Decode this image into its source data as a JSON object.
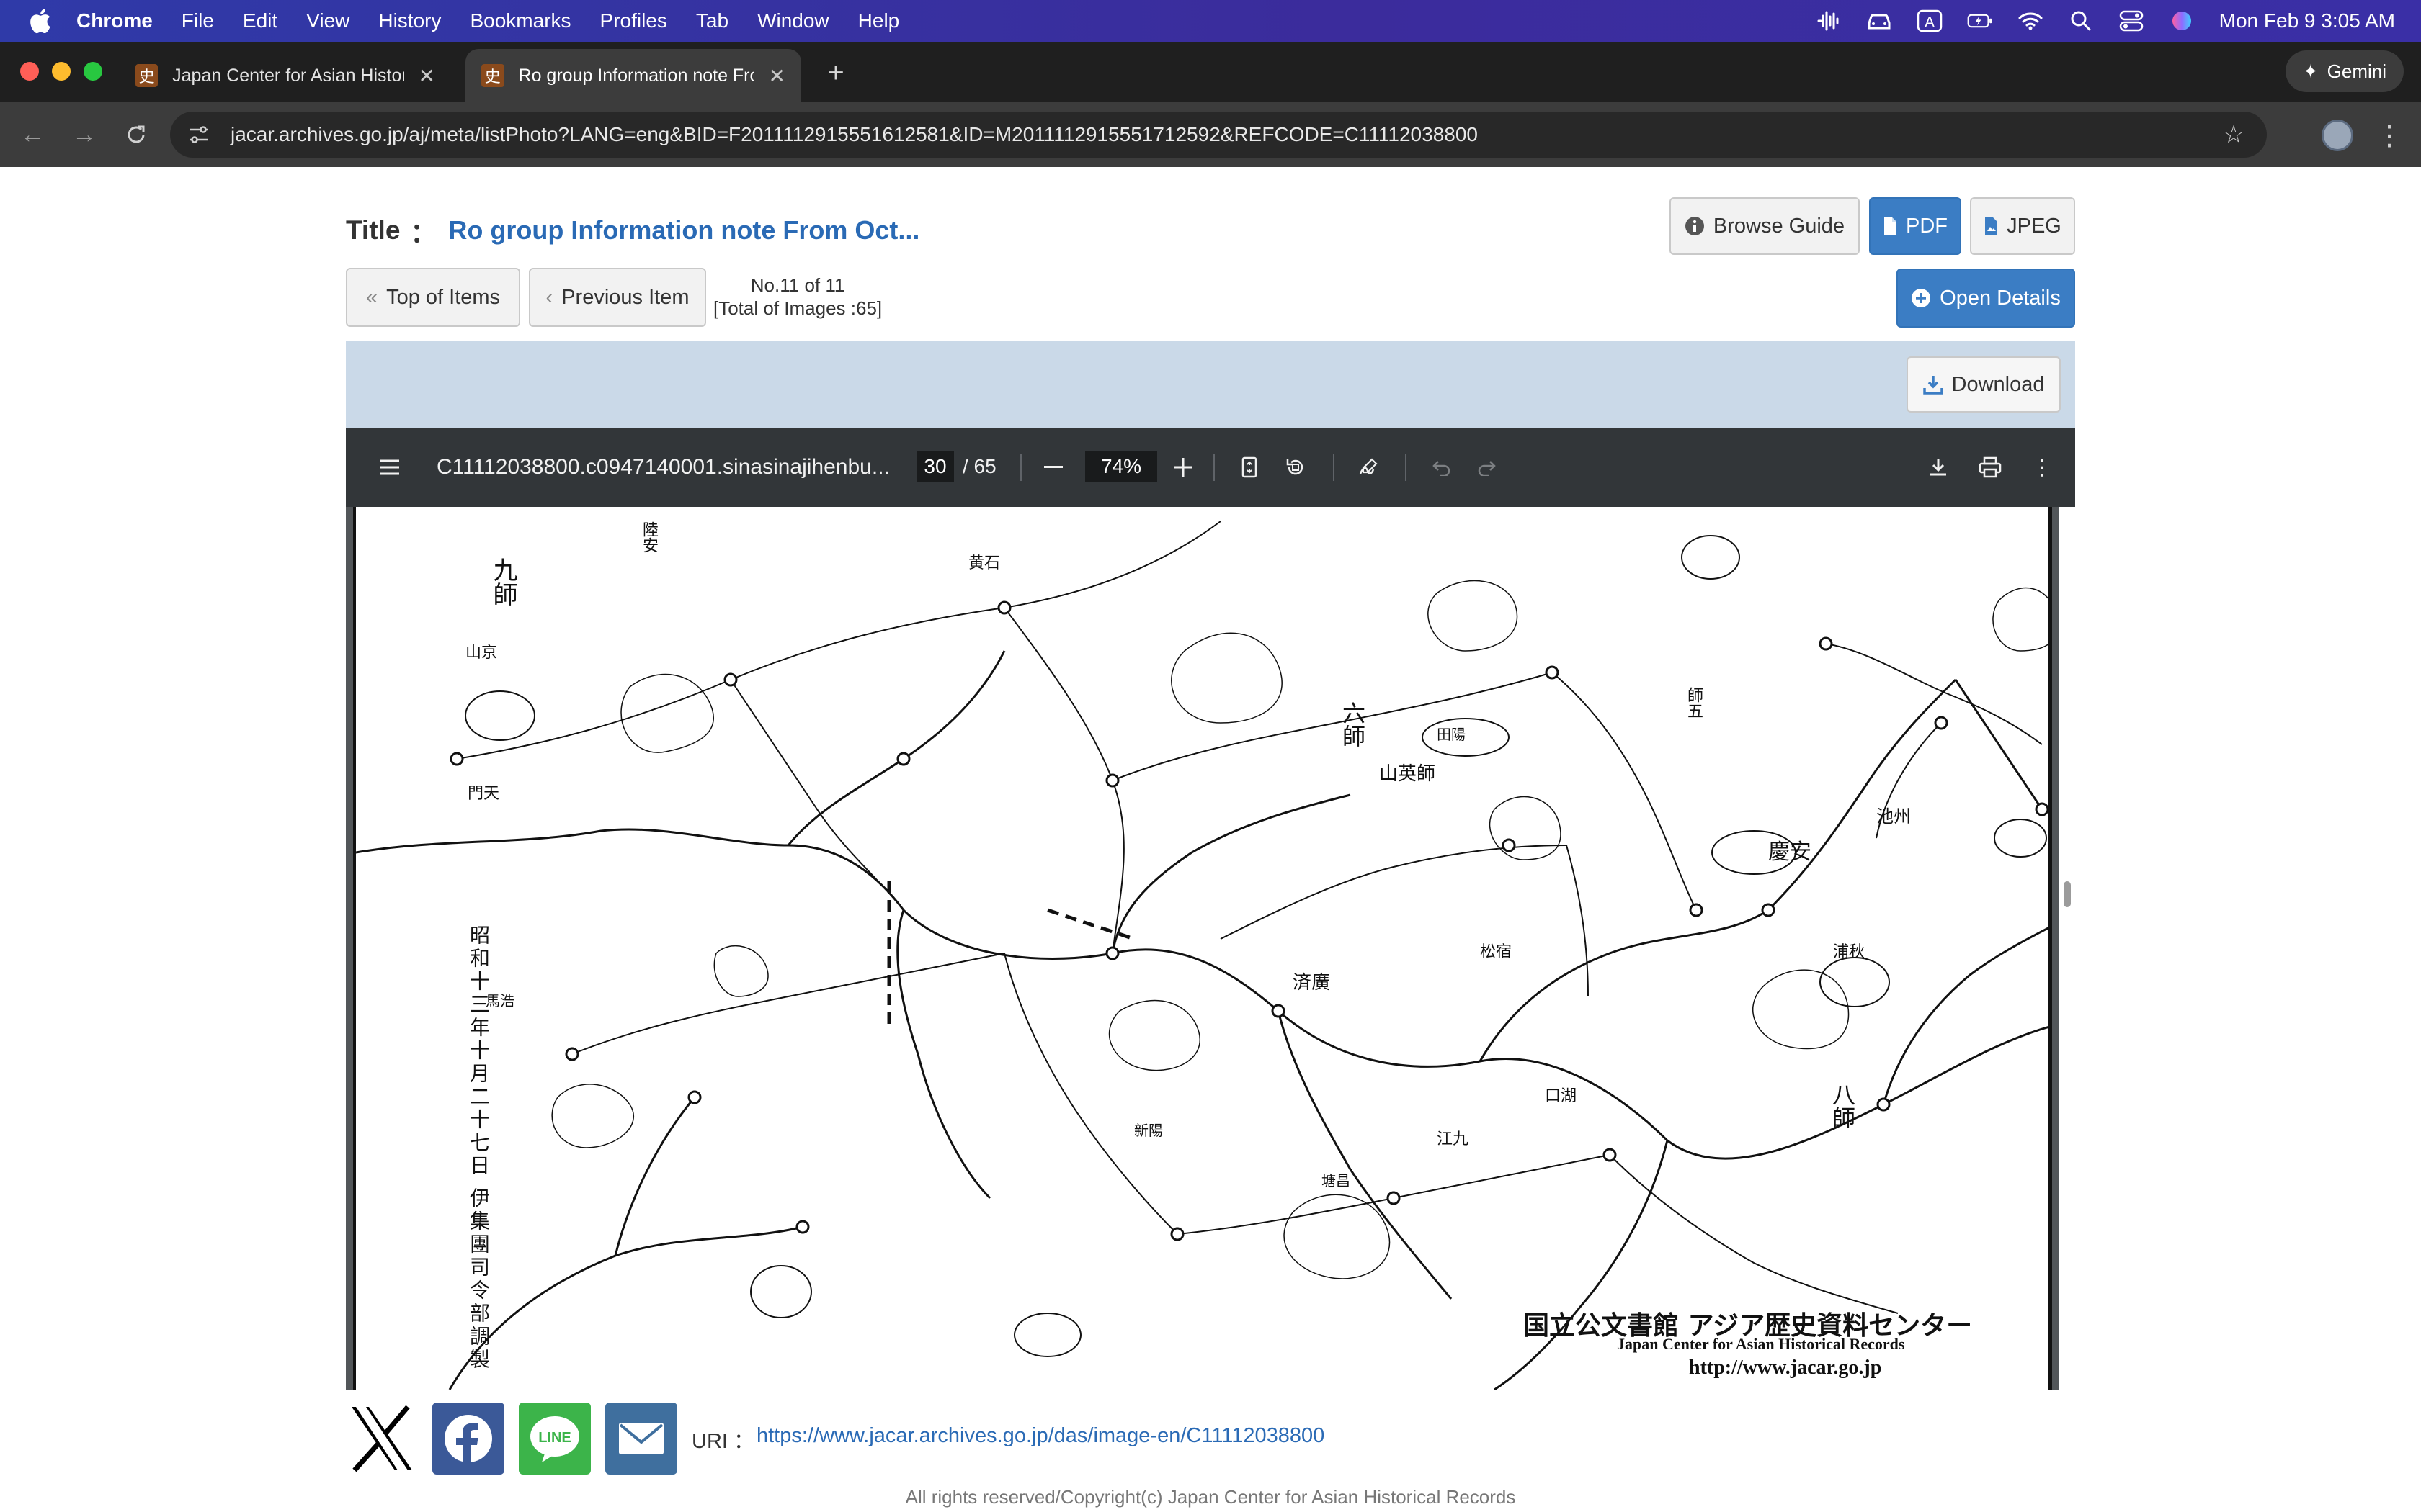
{
  "menubar": {
    "app": "Chrome",
    "items": [
      "File",
      "Edit",
      "View",
      "History",
      "Bookmarks",
      "Profiles",
      "Tab",
      "Window",
      "Help"
    ],
    "clock": "Mon Feb 9  3:05 AM"
  },
  "tabs": [
    {
      "title": "Japan Center for Asian Historical Records",
      "favicon": "史",
      "active": false
    },
    {
      "title": "Ro group Information note From Oct...",
      "favicon": "史",
      "active": true
    }
  ],
  "gemini": {
    "label": "Gemini"
  },
  "address": {
    "url": "jacar.archives.go.jp/aj/meta/listPhoto?LANG=eng&BID=F2011112915551612581&ID=M2011112915551712592&REFCODE=C11112038800"
  },
  "header": {
    "title_label": "Title",
    "title_colon": "：",
    "title_value": "Ro group Information note From Oct...",
    "browse_guide": "Browse Guide",
    "pdf": "PDF",
    "jpeg": "JPEG",
    "top_of_items": "Top of Items",
    "previous_item": "Previous Item",
    "item_no": "No.11 of 11",
    "total_images": "[Total of Images :65]",
    "open_details": "Open Details",
    "download": "Download"
  },
  "viewer": {
    "filename": "C11112038800.c0947140001.sinasinajihenbu...",
    "page": "30",
    "total": "/ 65",
    "zoom": "74%"
  },
  "pdf_content": {
    "watermark_jp": "国立公文書館 アジア歴史資料センター",
    "watermark_en": "Japan Center for Asian Historical Records",
    "watermark_url": "http://www.jacar.go.jp",
    "side_caption": "昭和十三年十月二十七日 伊集團司令部調製",
    "place_labels": [
      "九師",
      "六師",
      "八師",
      "山英師",
      "慶安",
      "済廣",
      "江九",
      "口湖",
      "松宿",
      "浦秋",
      "門天",
      "馬浩",
      "山京",
      "陸安",
      "黄石",
      "田陽",
      "塘昌",
      "師五",
      "新陽",
      "池州"
    ]
  },
  "footer": {
    "uri_label": "URI",
    "uri_colon": "：",
    "uri": "https://www.jacar.archives.go.jp/das/image-en/C11112038800",
    "copyright": "All rights reserved/Copyright(c) Japan Center for Asian Historical Records"
  },
  "colors": {
    "link": "#2a6ab5",
    "primary_button": "#3b7dc4",
    "band": "#cad9e8",
    "viewer_toolbar": "#323639",
    "x_brand": "#000000",
    "facebook": "#3b5998",
    "line": "#3cb44a",
    "mail": "#3f6f9e"
  }
}
